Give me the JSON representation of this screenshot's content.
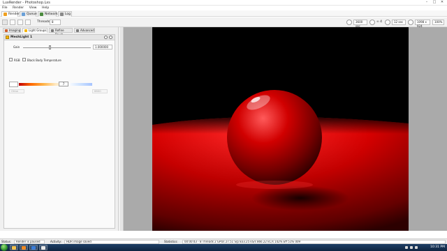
{
  "window": {
    "title": "LuxRender - Photoshop.Lxs",
    "controls": [
      "–",
      "□",
      "✕"
    ]
  },
  "menu": [
    "File",
    "Render",
    "View",
    "Help"
  ],
  "main_tabs": [
    {
      "label": "Render",
      "icon": "render-icon",
      "color": "#f0a020"
    },
    {
      "label": "Queue",
      "icon": "queue-icon",
      "color": "#6aa0d8"
    },
    {
      "label": "Network",
      "icon": "network-icon",
      "color": "#4c8b3f"
    },
    {
      "label": "Log",
      "icon": "log-icon",
      "color": "#8a8a8a"
    }
  ],
  "toolbar": {
    "threads_label": "Threads:",
    "threads_value": "8",
    "halt_time": "3600 sec",
    "halt_spp": "∞ 4",
    "interval": "12 sec",
    "resolution": "1098 x 924",
    "zoom": "100%"
  },
  "left_tabs": [
    {
      "label": "Imaging",
      "icon": "imaging-icon",
      "color": "#d06030"
    },
    {
      "label": "Light Groups",
      "icon": "light-groups-icon",
      "color": "#f4b400"
    },
    {
      "label": "Refine Brush",
      "icon": "brush-icon",
      "color": "#7a7a7a"
    },
    {
      "label": "Advanced",
      "icon": "advanced-icon",
      "color": "#7a7a7a"
    }
  ],
  "light_group": {
    "name": "MeshLight 1",
    "gain_label": "Gain",
    "gain_value": "1.000000",
    "gain_level": 0.4,
    "rgb_label": "RGB",
    "bbt_label": "Black Body Temperature",
    "temp_value": "7",
    "field_left": "Ohtw",
    "field_right": "6800"
  },
  "status": {
    "status_label": "Status:",
    "status_value": "Render is paused",
    "activity_label": "Activity:",
    "activity_value": "HDR image saved",
    "statistics_label": "Statistics:",
    "statistics_value": "00:00:43 - 8 Threads 2 GPUs 27.51 S/p 833.25 kS/s 866.22 kC/s 142% Eff 51% 009"
  },
  "taskbar": {
    "clock": "10:31 PM",
    "apps": [
      {
        "icon": "explorer-icon",
        "color": "#f2c14e"
      },
      {
        "icon": "media-player-icon",
        "color": "#f08a24"
      },
      {
        "icon": "browser-icon",
        "color": "#3b7dd8"
      },
      {
        "icon": "luxrender-icon",
        "color": "#e9e9e9"
      }
    ]
  },
  "colors": {
    "render_red": "#d10000",
    "accent": "#f4b400"
  }
}
